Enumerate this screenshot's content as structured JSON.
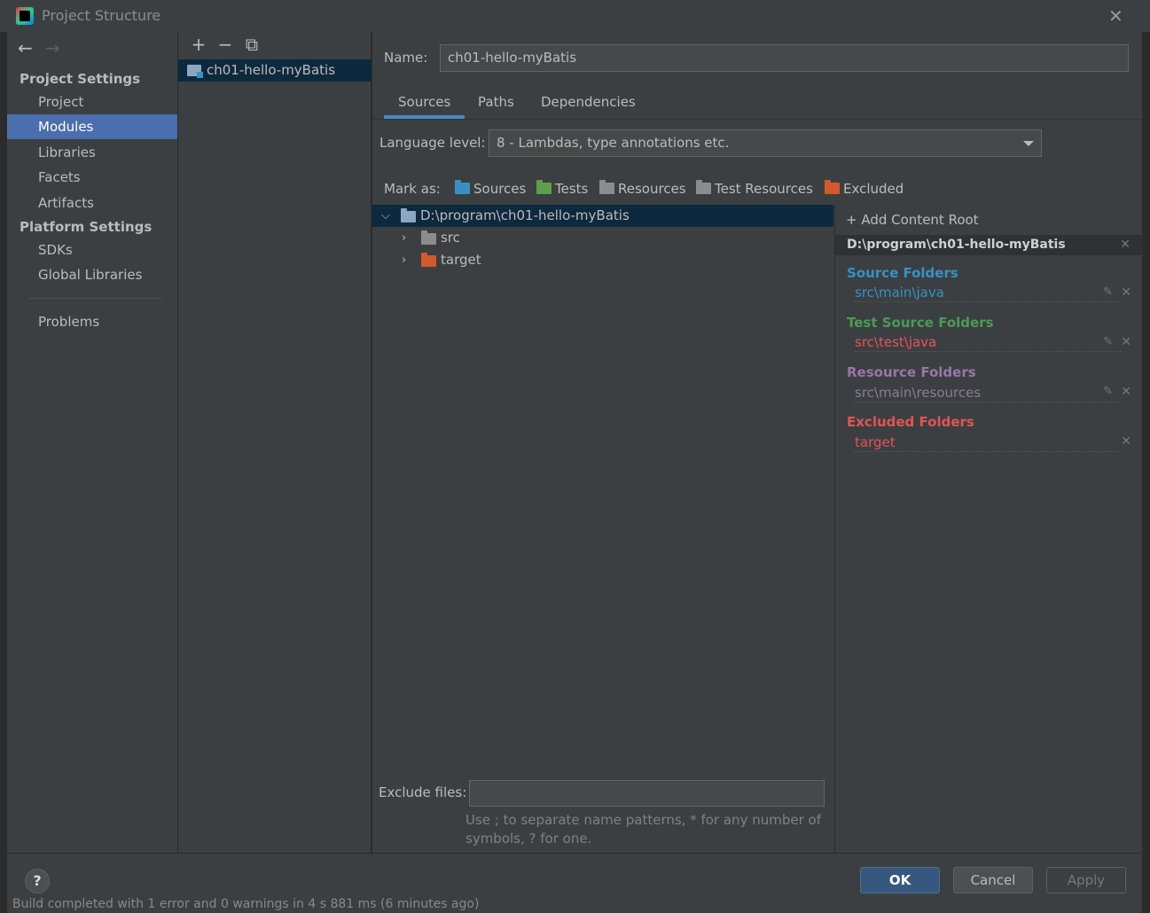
{
  "window": {
    "title": "Project Structure"
  },
  "nav": {
    "project_settings_header": "Project Settings",
    "platform_settings_header": "Platform Settings",
    "items": [
      "Project",
      "Modules",
      "Libraries",
      "Facets",
      "Artifacts"
    ],
    "platform_items": [
      "SDKs",
      "Global Libraries"
    ],
    "problems": "Problems",
    "selected": "Modules"
  },
  "modules": {
    "items": [
      "ch01-hello-myBatis"
    ]
  },
  "module": {
    "name_label": "Name:",
    "name_value": "ch01-hello-myBatis",
    "tabs": [
      "Sources",
      "Paths",
      "Dependencies"
    ],
    "active_tab": "Sources",
    "language_level_label": "Language level:",
    "language_level_value": "8 - Lambdas, type annotations etc.",
    "mark_as_label": "Mark as:",
    "mark_as": [
      {
        "label": "Sources",
        "color": "#3a8fc2"
      },
      {
        "label": "Tests",
        "color": "#5c9e49"
      },
      {
        "label": "Resources",
        "color": "#8c8c8c"
      },
      {
        "label": "Test Resources",
        "color": "#8c8c8c"
      },
      {
        "label": "Excluded",
        "color": "#d1592b"
      }
    ],
    "tree": [
      {
        "label": "D:\\program\\ch01-hello-myBatis",
        "expanded": true,
        "selected": true
      },
      {
        "label": "src",
        "expanded": false
      },
      {
        "label": "target",
        "expanded": false
      }
    ],
    "exclude_files_label": "Exclude files:",
    "exclude_files_value": "",
    "exclude_hint_1": "Use ; to separate name patterns, * for any number of",
    "exclude_hint_2": "symbols, ? for one."
  },
  "content_root": {
    "add_label": "Add Content Root",
    "path": "D:\\program\\ch01-hello-myBatis",
    "groups": [
      {
        "title": "Source Folders",
        "color": "#3592c4",
        "items": [
          "src\\main\\java"
        ],
        "item_color": "#3592c4"
      },
      {
        "title": "Test Source Folders",
        "color": "#499c54",
        "items": [
          "src\\test\\java"
        ],
        "item_color": "#e05555"
      },
      {
        "title": "Resource Folders",
        "color": "#9876aa",
        "items": [
          "src\\main\\resources"
        ],
        "item_color": "#8a7a9a"
      },
      {
        "title": "Excluded Folders",
        "color": "#e05555",
        "items": [
          "target"
        ],
        "item_color": "#e05555"
      }
    ]
  },
  "buttons": {
    "help": "?",
    "ok": "OK",
    "cancel": "Cancel",
    "apply": "Apply"
  },
  "status_peek": "Build completed with 1 error and 0 warnings in 4 s 881 ms (6 minutes ago)"
}
